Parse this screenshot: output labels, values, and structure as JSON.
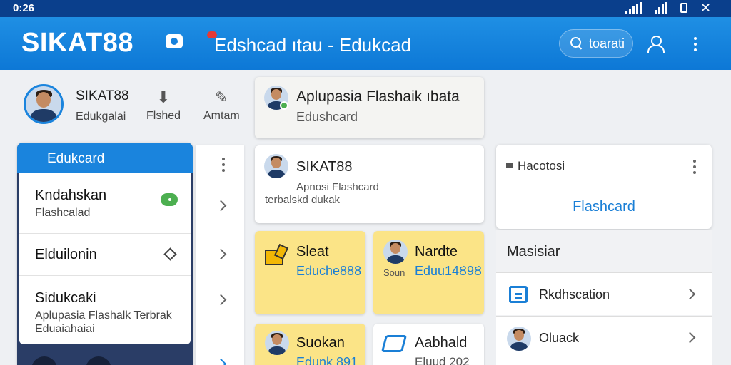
{
  "status_bar": {
    "time": "0:26"
  },
  "app_bar": {
    "brand": "SIKAT88",
    "title": "Edshcad ıtau - Edukcad",
    "search_label": "toarati"
  },
  "profile": {
    "name": "SIKAT88",
    "subtitle": "Edukgalai",
    "actions": [
      {
        "label": "Flshed",
        "icon": "download-icon"
      },
      {
        "label": "Amtam",
        "icon": "edit-pencil-icon"
      }
    ]
  },
  "left_panel": {
    "header": "Edukcard",
    "items": [
      {
        "title": "Kndahskan",
        "subtitle": "Flashcalad",
        "control": "toggle"
      },
      {
        "title": "Elduilonin",
        "subtitle": "",
        "control": "diamond"
      },
      {
        "title": "Sidukcaki",
        "subtitle": "Aplupasia Flashalk Terbrak",
        "subtitle2": "Eduaiahaiai",
        "control": ""
      }
    ]
  },
  "cards": {
    "top": {
      "title": "Aplupasia Flashaik ıbata",
      "subtitle": "Edushcard"
    },
    "user": {
      "name": "SIKAT88",
      "line1": "Apnosi Flashcard",
      "line2": "terbalskd dukak"
    },
    "sleat": {
      "title": "Sleat",
      "subtitle": "Eduche888",
      "icon": "box-icon"
    },
    "nardte": {
      "title": "Nardte",
      "subtitle": "Eduu14Ȣ9Ȣ",
      "small": "Soun",
      "icon": "avatar"
    },
    "suokan": {
      "title": "Suokan",
      "subtitle": "Edunk 891",
      "icon": "avatar"
    },
    "aabhald": {
      "title": "Aabhald",
      "subtitle": "Eluud 202",
      "icon": "handshake-icon"
    }
  },
  "right_panel": {
    "label": "Hacotosi",
    "action": "Flashcard",
    "section_header": "Masisiar",
    "rows": [
      {
        "label": "Rkdhscation",
        "icon": "document-icon"
      },
      {
        "label": "Oluack",
        "icon": "avatar"
      }
    ]
  },
  "colors": {
    "primary": "#1a84dd",
    "status_bar": "#0a3f8c",
    "card_yellow": "#fbe487",
    "link_blue": "#1a7fd6"
  }
}
